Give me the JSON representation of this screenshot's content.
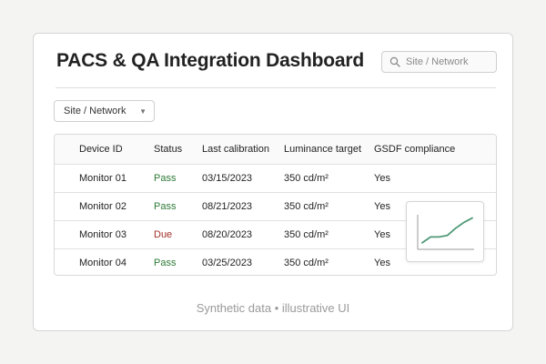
{
  "header": {
    "title": "PACS & QA Integration Dashboard",
    "search": {
      "placeholder": "Site / Network",
      "value": "",
      "icon": "search-icon"
    }
  },
  "filter": {
    "selected": "Site / Network",
    "icon": "chevron-down-icon"
  },
  "table": {
    "columns": [
      "Device ID",
      "Status",
      "Last calibration",
      "Luminance target",
      "GSDF compliance"
    ],
    "rows": [
      {
        "device": "Monitor 01",
        "status": "Pass",
        "date": "03/15/2023",
        "luminance": "350 cd/m²",
        "gsdf": "Yes"
      },
      {
        "device": "Monitor 02",
        "status": "Pass",
        "date": "08/21/2023",
        "luminance": "350 cd/m²",
        "gsdf": "Yes"
      },
      {
        "device": "Monitor 03",
        "status": "Due",
        "date": "08/20/2023",
        "luminance": "350 cd/m²",
        "gsdf": "Yes"
      },
      {
        "device": "Monitor 04",
        "status": "Pass",
        "date": "03/25/2023",
        "luminance": "350 cd/m²",
        "gsdf": "Yes"
      }
    ]
  },
  "colors": {
    "pass": "#2c7a36",
    "due": "#a2322b",
    "sparkline": "#4f9a78"
  },
  "sparkline": {
    "points": [
      0.1,
      0.3,
      0.3,
      0.35,
      0.6,
      0.8,
      0.95
    ]
  },
  "footer": {
    "text": "Synthetic data • illustrative UI"
  }
}
